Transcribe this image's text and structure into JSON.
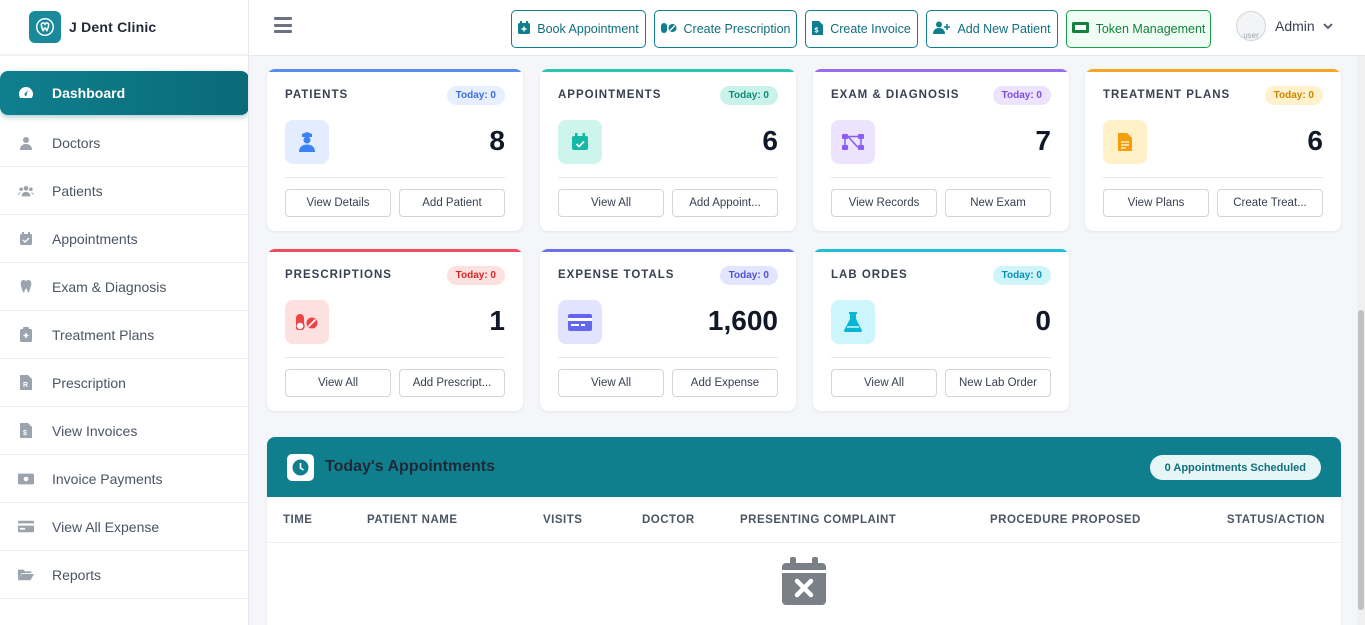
{
  "brand": {
    "name": "J Dent Clinic"
  },
  "sidebar": {
    "items": [
      {
        "label": "Dashboard",
        "icon": "gauge-icon",
        "active": true
      },
      {
        "label": "Doctors",
        "icon": "user-doctor-icon"
      },
      {
        "label": "Patients",
        "icon": "users-icon"
      },
      {
        "label": "Appointments",
        "icon": "calendar-check-icon"
      },
      {
        "label": "Exam & Diagnosis",
        "icon": "tooth-icon"
      },
      {
        "label": "Treatment Plans",
        "icon": "clipboard-medical-icon"
      },
      {
        "label": "Prescription",
        "icon": "prescription-icon"
      },
      {
        "label": "View Invoices",
        "icon": "invoice-icon"
      },
      {
        "label": "Invoice Payments",
        "icon": "money-icon"
      },
      {
        "label": "View All Expense",
        "icon": "credit-card-icon"
      },
      {
        "label": "Reports",
        "icon": "folder-open-icon"
      }
    ]
  },
  "topbar": {
    "buttons": {
      "book": "Book Appointment",
      "prescription": "Create Prescription",
      "invoice": "Create Invoice",
      "patient": "Add New Patient",
      "token": "Token Management"
    },
    "user": {
      "name": "Admin",
      "avatar_alt": "user"
    }
  },
  "cards": {
    "patients": {
      "title": "PATIENTS",
      "badge": "Today: 0",
      "value": "8",
      "btn1": "View Details",
      "btn2": "Add Patient",
      "color": "#3b82f6"
    },
    "appointments": {
      "title": "APPOINTMENTS",
      "badge": "Today: 0",
      "value": "6",
      "btn1": "View All",
      "btn2": "Add Appoint...",
      "color": "#14b8a6"
    },
    "exam": {
      "title": "EXAM & DIAGNOSIS",
      "badge": "Today: 0",
      "value": "7",
      "btn1": "View Records",
      "btn2": "New Exam",
      "color": "#8b5cf6"
    },
    "treatment": {
      "title": "TREATMENT PLANS",
      "badge": "Today: 0",
      "value": "6",
      "btn1": "View Plans",
      "btn2": "Create Treat...",
      "color": "#f59e0b"
    },
    "prescriptions": {
      "title": "PRESCRIPTIONS",
      "badge": "Today: 0",
      "value": "1",
      "btn1": "View All",
      "btn2": "Add Prescript...",
      "color": "#ef4444"
    },
    "expense": {
      "title": "EXPENSE TOTALS",
      "badge": "Today: 0",
      "value": "1,600",
      "btn1": "View All",
      "btn2": "Add Expense",
      "color": "#6366f1"
    },
    "lab": {
      "title": "LAB ORDES",
      "badge": "Today: 0",
      "value": "0",
      "btn1": "View All",
      "btn2": "New Lab Order",
      "color": "#06b6d4"
    }
  },
  "appointments_panel": {
    "title": "Today's Appointments",
    "badge": "0 Appointments Scheduled",
    "columns": [
      "TIME",
      "PATIENT NAME",
      "VISITS",
      "DOCTOR",
      "PRESENTING COMPLAINT",
      "PROCEDURE PROPOSED",
      "STATUS/ACTION"
    ],
    "rows": []
  }
}
